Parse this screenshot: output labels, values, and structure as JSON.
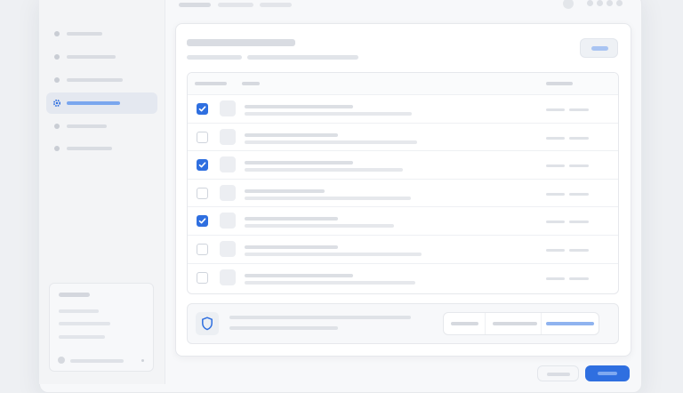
{
  "window": {
    "title": ""
  },
  "header": {
    "breadcrumb": [
      {
        "label": ""
      },
      {
        "label": ""
      },
      {
        "label": ""
      }
    ]
  },
  "sidebar": {
    "title": "",
    "items": [
      {
        "label": "",
        "active": false
      },
      {
        "label": "",
        "active": false
      },
      {
        "label": "",
        "active": false
      },
      {
        "label": "",
        "active": true
      },
      {
        "label": "",
        "active": false
      },
      {
        "label": "",
        "active": false
      }
    ],
    "info_card": {
      "title": "",
      "lines": [
        "",
        "",
        ""
      ],
      "user": ""
    }
  },
  "main": {
    "title": "",
    "subtitle": [
      "",
      ""
    ],
    "action_button": {
      "label": ""
    },
    "table": {
      "headers": [
        "",
        "",
        ""
      ],
      "rows": [
        {
          "checked": true,
          "title": "",
          "subtitle": "",
          "meta": [
            "",
            ""
          ]
        },
        {
          "checked": false,
          "title": "",
          "subtitle": "",
          "meta": [
            "",
            ""
          ]
        },
        {
          "checked": true,
          "title": "",
          "subtitle": "",
          "meta": [
            "",
            ""
          ]
        },
        {
          "checked": false,
          "title": "",
          "subtitle": "",
          "meta": [
            "",
            ""
          ]
        },
        {
          "checked": true,
          "title": "",
          "subtitle": "",
          "meta": [
            "",
            ""
          ]
        },
        {
          "checked": false,
          "title": "",
          "subtitle": "",
          "meta": [
            "",
            ""
          ]
        },
        {
          "checked": false,
          "title": "",
          "subtitle": "",
          "meta": [
            "",
            ""
          ]
        }
      ]
    },
    "security_panel": {
      "icon": "shield-icon",
      "text": [
        "",
        ""
      ],
      "segments": [
        {
          "label": ""
        },
        {
          "label": ""
        },
        {
          "label": "",
          "selected": true
        }
      ]
    }
  },
  "footer": {
    "cancel_label": "",
    "confirm_label": ""
  },
  "colors": {
    "accent": "#2f6fe0",
    "placeholder": "#e2e5ea",
    "background": "#eef0f3"
  }
}
